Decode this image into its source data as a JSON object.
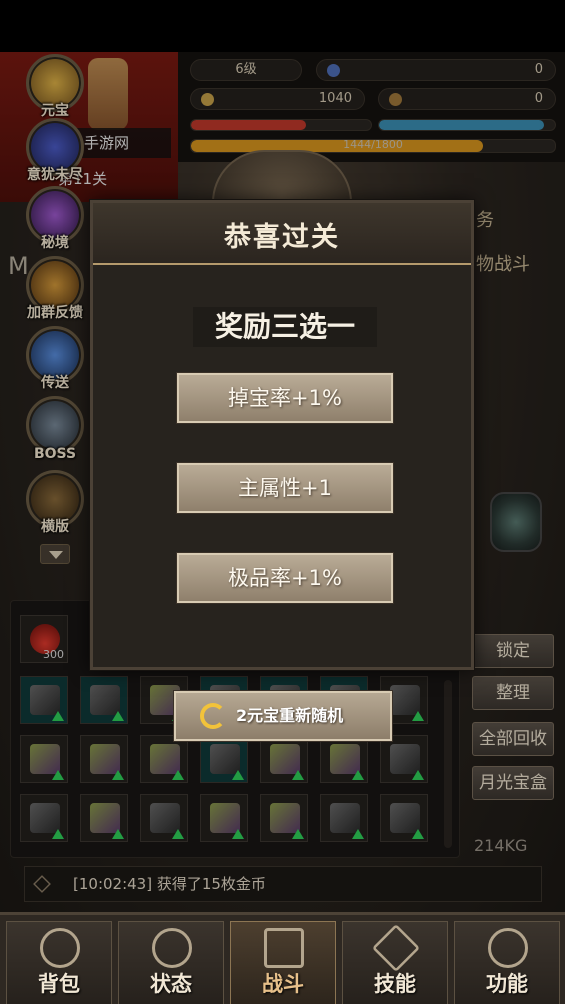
{
  "player": {
    "level": "6级",
    "gems": "0",
    "gold": "1040",
    "fragments": "0",
    "exp_text": "1444/1800",
    "exp_progress": 0.802,
    "hp_progress": 0.64,
    "mp_progress": 0.94
  },
  "side_menu": [
    {
      "label": "元宝"
    },
    {
      "label": "意犹未尽"
    },
    {
      "label": "秘境"
    },
    {
      "label": "加群反馈"
    },
    {
      "label": "传送"
    },
    {
      "label": "BOSS"
    },
    {
      "label": "横版"
    }
  ],
  "background": {
    "site": "手游网",
    "stage": "第11关",
    "task_text": "务",
    "fight_text": "物战斗",
    "letter": "M"
  },
  "dialog": {
    "title": "恭喜过关",
    "subtitle": "奖励三选一",
    "choices": [
      {
        "label": "掉宝率+1%"
      },
      {
        "label": "主属性+1"
      },
      {
        "label": "极品率+1%"
      }
    ],
    "reroll_label": "2元宝重新随机"
  },
  "inventory": {
    "potion_count": "300",
    "weight": "214KG"
  },
  "side_buttons": [
    {
      "label": "锁定"
    },
    {
      "label": "整理"
    },
    {
      "label": "全部回收"
    },
    {
      "label": "月光宝盒"
    }
  ],
  "log": {
    "text": "[10:02:43] 获得了15枚金币"
  },
  "nav": [
    {
      "label": "背包",
      "icon": "bag-icon"
    },
    {
      "label": "状态",
      "icon": "status-icon"
    },
    {
      "label": "战斗",
      "icon": "battle-icon"
    },
    {
      "label": "技能",
      "icon": "skill-icon"
    },
    {
      "label": "功能",
      "icon": "function-icon"
    }
  ],
  "colors": {
    "hp": "#c0392b",
    "mp": "#3b8fb5",
    "exp": "#d9961e",
    "upgrade_arrow": "#2fd15a"
  }
}
